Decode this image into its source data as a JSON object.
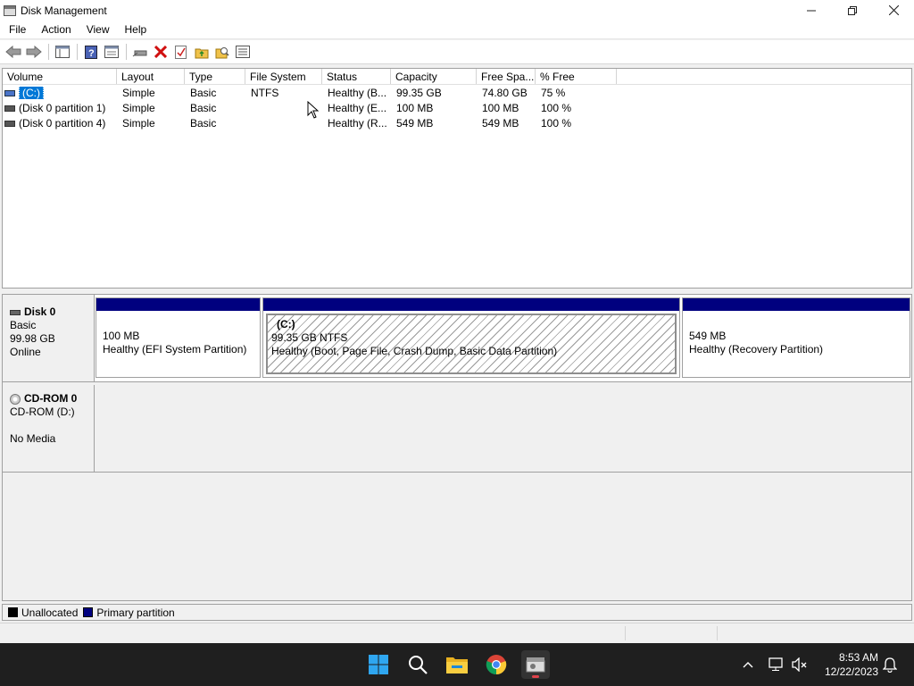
{
  "window": {
    "title": "Disk Management"
  },
  "menu": [
    "File",
    "Action",
    "View",
    "Help"
  ],
  "toolbar": [
    "back-icon",
    "forward-icon",
    "console-tree-icon",
    "help-icon",
    "properties-icon",
    "connect-drive-icon",
    "delete-icon",
    "check-icon",
    "folder-up-icon",
    "search-icon",
    "list-icon"
  ],
  "volume_list": {
    "columns": [
      "Volume",
      "Layout",
      "Type",
      "File System",
      "Status",
      "Capacity",
      "Free Spa...",
      "% Free"
    ],
    "rows": [
      [
        "(C:)",
        "Simple",
        "Basic",
        "NTFS",
        "Healthy (B...",
        "99.35 GB",
        "74.80 GB",
        "75 %"
      ],
      [
        "(Disk 0 partition 1)",
        "Simple",
        "Basic",
        "",
        "Healthy (E...",
        "100 MB",
        "100 MB",
        "100 %"
      ],
      [
        "(Disk 0 partition 4)",
        "Simple",
        "Basic",
        "",
        "Healthy (R...",
        "549 MB",
        "549 MB",
        "100 %"
      ]
    ]
  },
  "disks": [
    {
      "name": "Disk 0",
      "kind": "Basic",
      "size": "99.98 GB",
      "state": "Online",
      "partitions": [
        {
          "name": "",
          "size": "100 MB",
          "status": "Healthy (EFI System Partition)"
        },
        {
          "name": "(C:)",
          "size": "99.35 GB NTFS",
          "status": "Healthy (Boot, Page File, Crash Dump, Basic Data Partition)"
        },
        {
          "name": "",
          "size": "549 MB",
          "status": "Healthy (Recovery Partition)"
        }
      ]
    },
    {
      "name": "CD-ROM 0",
      "kind": "CD-ROM (D:)",
      "size": "",
      "state": "No Media"
    }
  ],
  "legend": [
    {
      "label": "Unallocated",
      "color": "#000000"
    },
    {
      "label": "Primary partition",
      "color": "#00007f"
    }
  ],
  "clock": {
    "time": "8:53 AM",
    "date": "12/22/2023"
  },
  "taskbar": [
    "start-icon",
    "search-icon",
    "file-explorer-icon",
    "chrome-icon",
    "disk-management-icon"
  ]
}
